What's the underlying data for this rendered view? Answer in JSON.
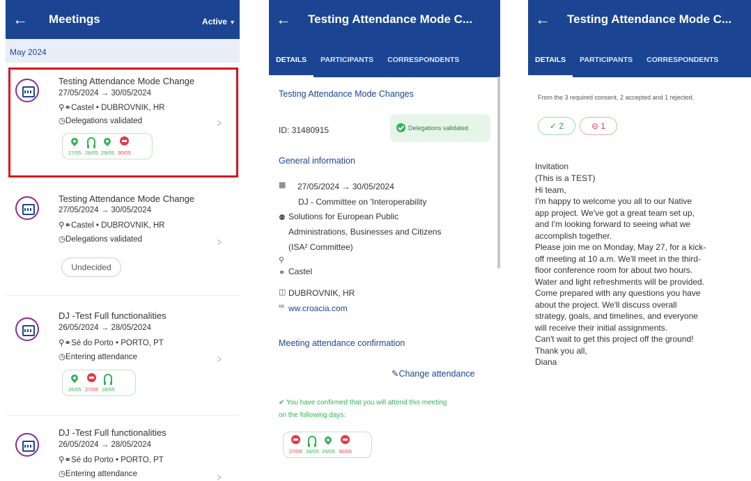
{
  "screen1": {
    "back_icon": "arrow-left-icon",
    "title": "Meetings",
    "filter": "Active",
    "month": "May 2024",
    "meetings": [
      {
        "title": "Testing Attendance Mode Change",
        "dates": "27/05/2024 → 30/05/2024",
        "location": "Castel • DUBROVNIK, HR",
        "status": "Delegations validated",
        "days": [
          {
            "icon": "pin",
            "date": "27/05",
            "color": "#33b255"
          },
          {
            "icon": "headphones",
            "date": "28/05",
            "color": "#33b255"
          },
          {
            "icon": "pin",
            "date": "29/05",
            "color": "#33b255"
          },
          {
            "icon": "no",
            "date": "30/05",
            "color": "#e23b4b"
          }
        ]
      },
      {
        "title": "Testing Attendance Mode Change",
        "dates": "27/05/2024 → 30/05/2024",
        "location": "Castel • DUBROVNIK, HR",
        "status": "Delegations validated",
        "badge": "Undecided"
      },
      {
        "title": "DJ -Test Full functionalities",
        "dates": "26/05/2024 → 28/05/2024",
        "location": "Sé do Porto • PORTO, PT",
        "status": "Entering attendance",
        "days": [
          {
            "icon": "pin",
            "date": "26/05",
            "color": "#33b255"
          },
          {
            "icon": "no",
            "date": "27/05",
            "color": "#e23b4b"
          },
          {
            "icon": "headphones",
            "date": "28/05",
            "color": "#33b255"
          }
        ]
      },
      {
        "title": "DJ -Test Full functionalities",
        "dates": "26/05/2024 → 28/05/2024",
        "location": "Sé do Porto • PORTO, PT",
        "status": "Entering attendance"
      }
    ]
  },
  "screen2": {
    "title": "Testing Attendance Mode C...",
    "tabs": [
      "DETAILS",
      "PARTICIPANTS",
      "CORRESPONDENTS"
    ],
    "meeting_title": "Testing Attendance Mode Changes",
    "id": "ID: 31480915",
    "badge": "Delegations validated",
    "general_heading": "General information",
    "dates": "27/05/2024 → 30/05/2024",
    "committee": [
      "DJ - Committee on 'Interoperability",
      "Solutions for European Public",
      "Administrations, Businesses and Citizens",
      "(ISA² Committee)"
    ],
    "venue": "Castel",
    "city": "DUBROVNIK, HR",
    "link": "ww.croacia.com",
    "attendance_heading": "Meeting attendance confirmation",
    "change_button": "Change attendance",
    "confirm_text": [
      "You have confirmed that you will attend this meeting",
      "on the following days:"
    ],
    "days": [
      {
        "icon": "no",
        "date": "27/05",
        "color": "#e23b4b"
      },
      {
        "icon": "headphones",
        "date": "28/05",
        "color": "#33b255"
      },
      {
        "icon": "pin",
        "date": "29/05",
        "color": "#33b255"
      },
      {
        "icon": "no",
        "date": "30/05",
        "color": "#e23b4b"
      }
    ]
  },
  "screen3": {
    "title": "Testing Attendance Mode C...",
    "tabs": [
      "DETAILS",
      "PARTICIPANTS",
      "CORRESPONDENTS"
    ],
    "consent_summary": "From the 3 required consent, 2 accepted and 1 rejected.",
    "accepted": "✓ 2",
    "rejected": "⊝ 1",
    "invitation_heading": "Invitation",
    "invitation_lines": [
      "(This is a TEST)",
      "Hi team,",
      "I'm happy to welcome you all to our Native",
      "app project. We've got a great team set up,",
      "and I'm looking forward to seeing what we",
      "accomplish together.",
      "Please join me on Monday, May 27, for a kick-",
      "off meeting at 10 a.m. We'll meet in the third-",
      "floor conference room for about two hours.",
      "Water and light refreshments will be provided.",
      "Come prepared with any questions you have",
      "about the project. We'll discuss overall",
      "strategy, goals, and timelines, and everyone",
      "will receive their initial assignments.",
      "Can't wait to get this project off the ground!",
      "Thank you all,",
      "Diana"
    ]
  }
}
